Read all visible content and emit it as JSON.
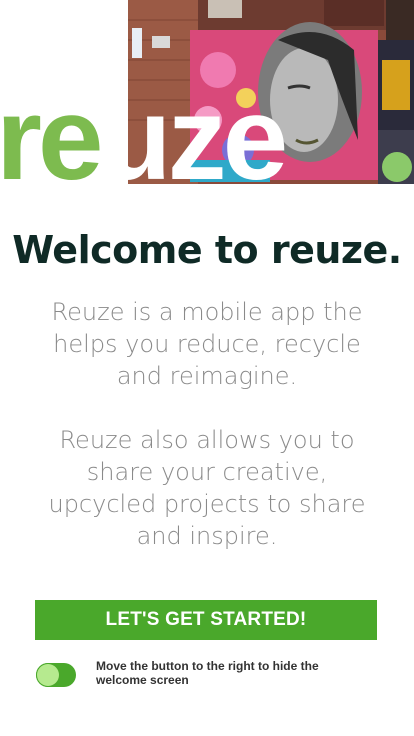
{
  "logo": {
    "part1": "re",
    "part2": "uze"
  },
  "welcome": {
    "title": "Welcome to reuze.",
    "paragraph1": "Reuze is a mobile app the helps you reduce, recycle and reimagine.",
    "paragraph2": "Reuze also allows you to share your creative, upcycled projects to share and inspire."
  },
  "cta": {
    "label": "LET'S GET STARTED!"
  },
  "toggle": {
    "label": "Move the button to the right to hide the welcome screen",
    "state": "off"
  },
  "colors": {
    "accent": "#4aa82b",
    "logo_green": "#7dbb4f",
    "title": "#0f2a26",
    "body_text": "#8a8a8a"
  }
}
